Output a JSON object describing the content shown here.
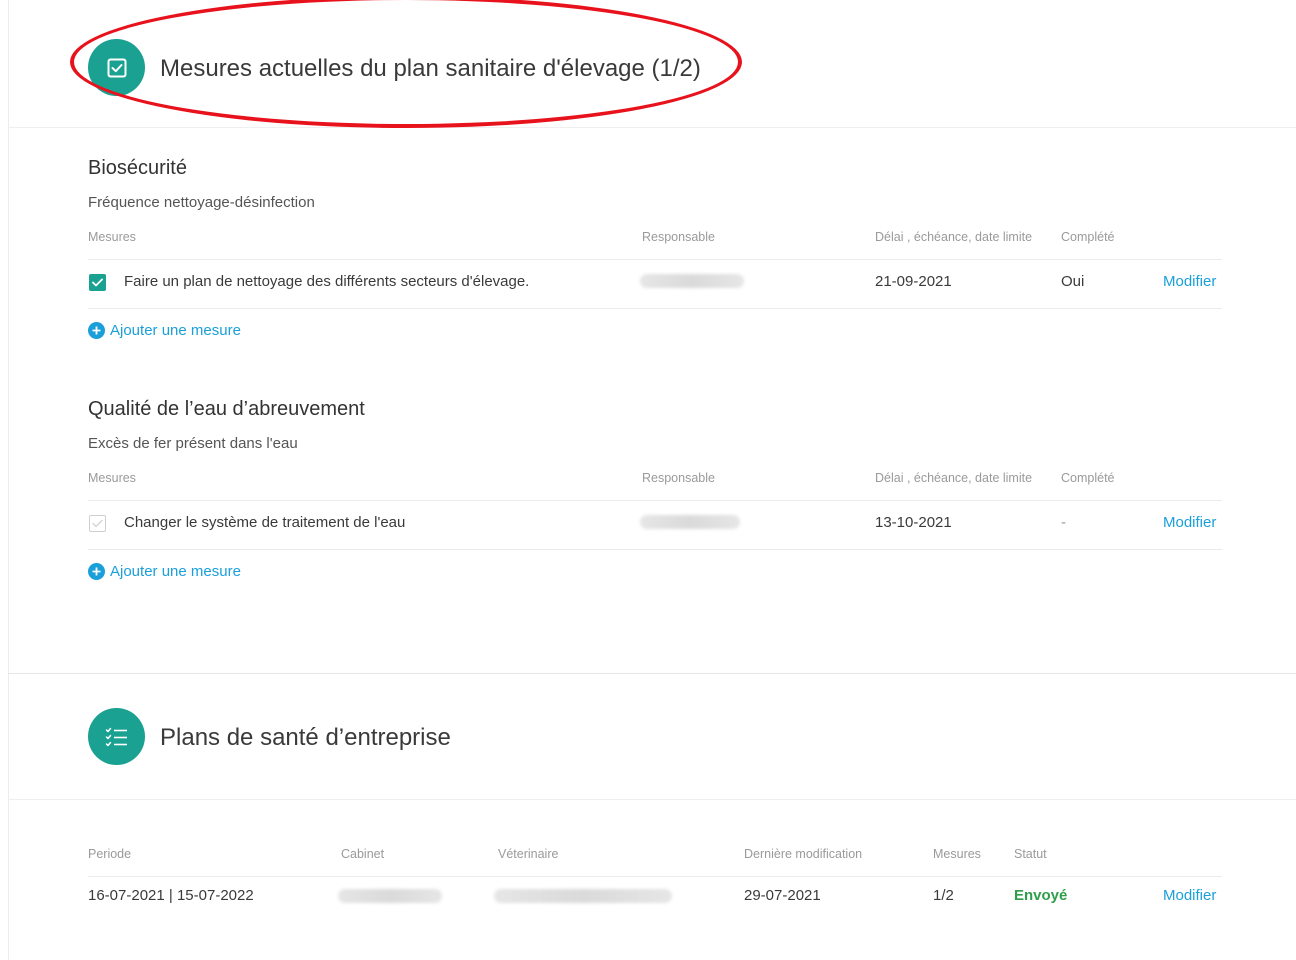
{
  "measures_section": {
    "title": "Mesures actuelles du plan sanitaire d'élevage (1/2)",
    "icon": "checkbox-icon"
  },
  "groups": [
    {
      "title": "Biosécurité",
      "subtitle": "Fréquence nettoyage-désinfection",
      "columns": [
        "Mesures",
        "Responsable",
        "Délai , échéance, date limite",
        "Complété"
      ],
      "row": {
        "checked": true,
        "measure": "Faire un plan de nettoyage des différents secteurs d'élevage.",
        "deadline": "21-09-2021",
        "completed": "Oui",
        "action": "Modifier"
      },
      "add_label": "Ajouter une mesure"
    },
    {
      "title": "Qualité de l’eau d’abreuvement",
      "subtitle": "Excès de fer présent dans l'eau",
      "columns": [
        "Mesures",
        "Responsable",
        "Délai , échéance, date limite",
        "Complété"
      ],
      "row": {
        "checked": false,
        "measure": "Changer le système de traitement de l'eau",
        "deadline": "13-10-2021",
        "completed": "-",
        "action": "Modifier"
      },
      "add_label": "Ajouter une mesure"
    }
  ],
  "plans_section": {
    "title": "Plans de santé d’entreprise",
    "icon": "checklist-icon",
    "columns": [
      "Periode",
      "Cabinet",
      "Véterinaire",
      "Dernière modification",
      "Mesures",
      "Statut"
    ],
    "row": {
      "period": "16-07-2021 | 15-07-2022",
      "last_modified": "29-07-2021",
      "measures": "1/2",
      "status": "Envoyé",
      "action": "Modifier"
    }
  },
  "colors": {
    "accent_teal": "#1aa191",
    "link_blue": "#1a9fd9",
    "status_green": "#2e9e4a",
    "highlight_red": "#e8121c"
  }
}
